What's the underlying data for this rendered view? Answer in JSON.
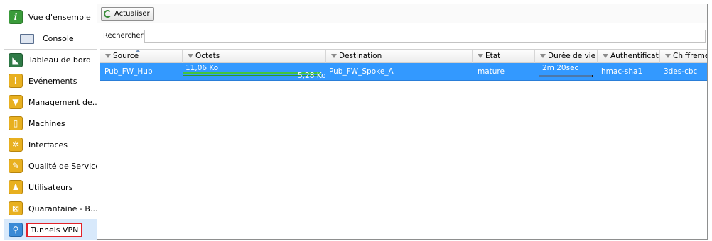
{
  "sidebar": {
    "items": [
      {
        "label": "Vue d'ensemble",
        "icon": "info-icon"
      },
      {
        "label": "Console",
        "icon": "console-icon"
      },
      {
        "label": "Tableau de bord",
        "icon": "dashboard-icon"
      },
      {
        "label": "Evénements",
        "icon": "warning-icon"
      },
      {
        "label": "Management de...",
        "icon": "shield-icon"
      },
      {
        "label": "Machines",
        "icon": "machine-icon"
      },
      {
        "label": "Interfaces",
        "icon": "network-icon"
      },
      {
        "label": "Qualité de Service",
        "icon": "qos-icon"
      },
      {
        "label": "Utilisateurs",
        "icon": "users-icon"
      },
      {
        "label": "Quarantaine - B...",
        "icon": "quarantine-icon"
      },
      {
        "label": "Tunnels VPN",
        "icon": "vpn-icon",
        "selected": true
      }
    ]
  },
  "toolbar": {
    "refresh_label": "Actualiser"
  },
  "search": {
    "label": "Rechercher:",
    "value": ""
  },
  "table": {
    "columns": [
      "Source",
      "Octets",
      "Destination",
      "Etat",
      "Durée de vie",
      "Authentificatio",
      "Chiffrement"
    ],
    "rows": [
      {
        "source": "Pub_FW_Hub",
        "bytes_in": "11,06 Ko",
        "bytes_out": "5,28 Ko",
        "destination": "Pub_FW_Spoke_A",
        "state": "mature",
        "lifetime": "2m 20sec",
        "lifetime_fraction": 0.97,
        "auth": "hmac-sha1",
        "cipher": "3des-cbc"
      }
    ]
  },
  "colors": {
    "selection": "#3399ff",
    "highlight_border": "#e3232a",
    "bytes_bar": "#41c441"
  }
}
